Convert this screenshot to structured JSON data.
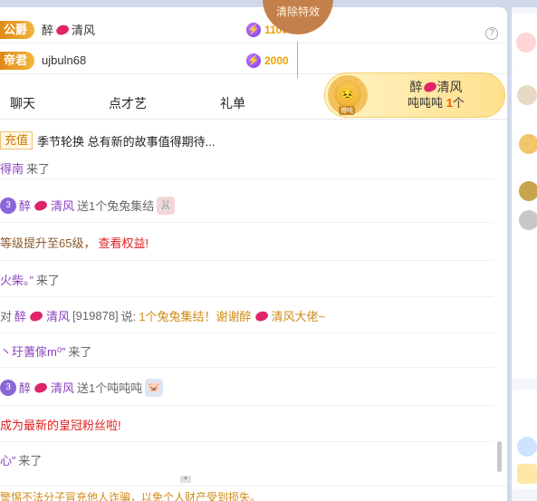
{
  "top_ranks": [
    {
      "badge": "公爵",
      "name_a": "醉",
      "name_b": "清风",
      "score": "1100"
    },
    {
      "badge": "帝君",
      "name_a": "ujbuln68",
      "name_b": "",
      "score": "2000"
    }
  ],
  "clear_effects_label": "清除特效",
  "help_icon": "?",
  "tabs": [
    "聊天",
    "点才艺",
    "礼单"
  ],
  "gift_banner": {
    "sender_a": "醉",
    "sender_b": "清风",
    "gift": "吨吨吨",
    "count": "1",
    "unit": "个",
    "emoji_tag": "爆吨"
  },
  "notice": {
    "tag": "充值",
    "text": "季节轮换 总有新的故事值得期待..."
  },
  "messages": {
    "m0": {
      "text": "得南",
      "tail": "来了"
    },
    "m1": {
      "name_a": "醉",
      "name_b": "清风",
      "action": "送1个兔兔集结"
    },
    "m2": {
      "text": "等级提升至65级，",
      "link": "查看权益!"
    },
    "m3": {
      "name": "火柴。”",
      "tail": "来了"
    },
    "m4": {
      "prefix": "对",
      "name_a": "醉",
      "name_b": "清风",
      "id": "[919878]",
      "say": "说:",
      "thanks_a": "1个兔兔集结！谢谢醉",
      "thanks_b": "清风大佬~"
    },
    "m5": {
      "name": "丶玗蓍傢m⁰”",
      "tail": "来了"
    },
    "m6": {
      "name_a": "醉",
      "name_b": "清风",
      "action": "送1个吨吨吨"
    },
    "m7": {
      "text": "成为最新的皇冠粉丝啦!"
    },
    "m8": {
      "name": "心”",
      "tail": "来了"
    }
  },
  "warning_text": "警惕不法分子冒充他人诈骗，以免个人财产受到损失。",
  "colors": {
    "accent_gold": "#f2a100",
    "purple_name": "#8a3fbf",
    "red_text": "#e02020",
    "lips": "#e0246a"
  },
  "icons": [
    "bolt-icon",
    "lips-icon",
    "help-icon",
    "gift-icon",
    "chevron-right-icon"
  ]
}
